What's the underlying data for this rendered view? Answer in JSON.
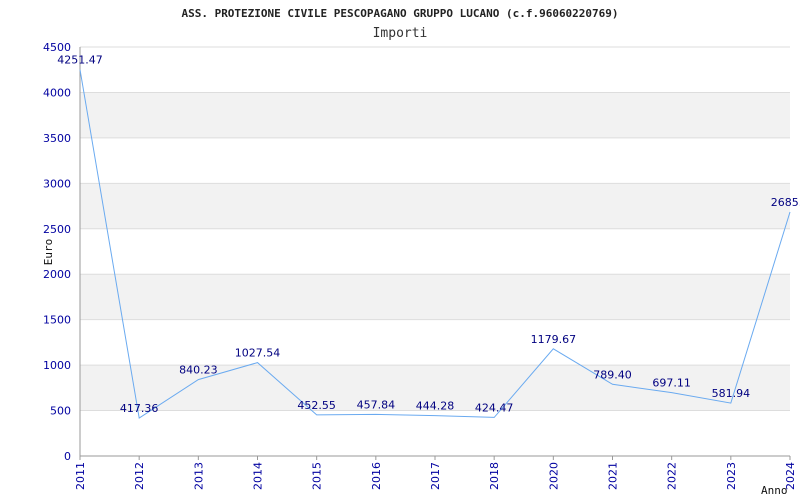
{
  "chart_data": {
    "type": "line",
    "title": "ASS. PROTEZIONE CIVILE PESCOPAGANO GRUPPO LUCANO (c.f.96060220769)",
    "subtitle": "Importi",
    "xlabel": "Anno",
    "ylabel": "Euro",
    "ylim": [
      0,
      4500
    ],
    "yticks": [
      0,
      500,
      1000,
      1500,
      2000,
      2500,
      3000,
      3500,
      4000,
      4500
    ],
    "grid": true,
    "x": [
      "2011",
      "2012",
      "2013",
      "2014",
      "2015",
      "2016",
      "2017",
      "2018",
      "2020",
      "2021",
      "2022",
      "2023",
      "2024"
    ],
    "values": [
      4251.47,
      417.36,
      840.23,
      1027.54,
      452.55,
      457.84,
      444.28,
      424.47,
      1179.67,
      789.4,
      697.11,
      581.94,
      2685.0
    ],
    "value_labels": [
      "4251.47",
      "417.36",
      "840.23",
      "1027.54",
      "452.55",
      "457.84",
      "444.28",
      "424.47",
      "1179.67",
      "789.40",
      "697.11",
      "581.94",
      "2685.0"
    ],
    "colors": {
      "line": "#6aaaf0",
      "band": "#f2f2f2",
      "grid": "#dddddd",
      "tick_text": "#0000a0",
      "label_text": "#000080"
    }
  }
}
